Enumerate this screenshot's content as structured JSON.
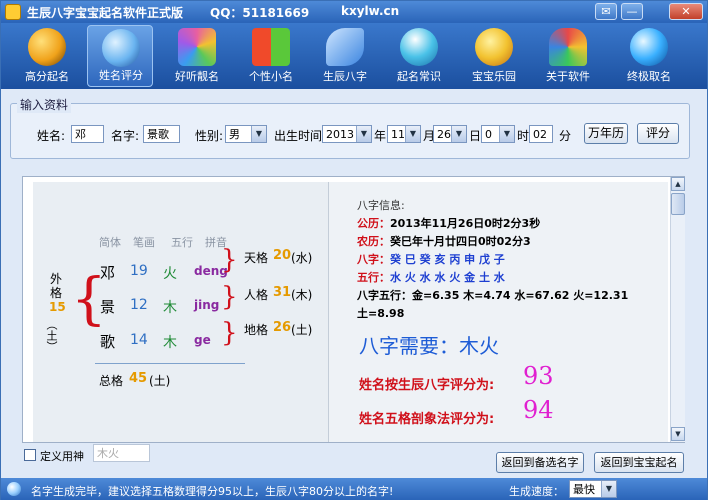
{
  "window": {
    "title": "生辰八字宝宝起名软件正式版",
    "qq": "QQ：51181669",
    "site": "kxylw.cn",
    "controls": [
      "✉",
      "—",
      "✕"
    ]
  },
  "toolbar": {
    "items": [
      {
        "label": "高分起名",
        "icon": "yin-yang-icon",
        "color": "#f0a21a"
      },
      {
        "label": "姓名评分",
        "icon": "globe-icon",
        "color": "#6ab4f0"
      },
      {
        "label": "好听靓名",
        "icon": "cubes-icon",
        "color": "#e85fa0"
      },
      {
        "label": "个性小名",
        "icon": "windows-icon",
        "color": "#f0c21a"
      },
      {
        "label": "生辰八字",
        "icon": "leaves-icon",
        "color": "#5aa0f0"
      },
      {
        "label": "起名常识",
        "icon": "person-icon",
        "color": "#4ac2e8"
      },
      {
        "label": "宝宝乐园",
        "icon": "duck-icon",
        "color": "#f2c230"
      },
      {
        "label": "关于软件",
        "icon": "butterfly-icon",
        "color": "#e84848"
      },
      {
        "label": "终极取名",
        "icon": "ie-globe-icon",
        "color": "#3ab0ff"
      }
    ]
  },
  "input_group": {
    "title": "输入资料",
    "surname_label": "姓名:",
    "surname_value": "邓",
    "name_label": "名字:",
    "name_value": "景歌",
    "gender_label": "性别:",
    "gender_value": "男",
    "birth_label": "出生时间",
    "year_value": "2013",
    "year_unit": "年",
    "month_value": "11",
    "month_unit": "月",
    "day_value": "26",
    "day_unit": "日",
    "hour_value": "0",
    "hour_unit": "时",
    "minute_value": "02",
    "minute_unit": "分",
    "calendar_button": "万年历",
    "score_button": "评分"
  },
  "wuge": {
    "headers": [
      "简体",
      "笔画",
      "五行",
      "拼音"
    ],
    "chars": [
      {
        "char": "邓",
        "strokes": "19",
        "element": "火",
        "pinyin": "deng"
      },
      {
        "char": "景",
        "strokes": "12",
        "element": "木",
        "pinyin": "jing"
      },
      {
        "char": "歌",
        "strokes": "14",
        "element": "木",
        "pinyin": "ge"
      }
    ],
    "outer_label_1": "外",
    "outer_label_2": "格",
    "outer_value": "15",
    "outer_element": "（土）",
    "tian_label": "天格",
    "tian_value": "20",
    "tian_element": "(水)",
    "ren_label": "人格",
    "ren_value": "31",
    "ren_element": "(木)",
    "di_label": "地格",
    "di_value": "26",
    "di_element": "(土)",
    "total_label": "总格",
    "total_value": "45",
    "total_element": "(土)"
  },
  "bazi": {
    "heading": "八字信息:",
    "solar_label": "公历：",
    "solar_value": "2013年11月26日0时2分3秒",
    "lunar_label": "农历：",
    "lunar_value": "癸巳年十月廿四日0时02分3",
    "bazi_label": "八字：",
    "bazi_value": "癸 巳 癸 亥 丙 申 戊 子",
    "wuxing_label": "五行：",
    "wuxing_value": "水 火 水 水 火 金 土 水",
    "bazi_wuxing_line1": "八字五行：金=6.35 木=4.74 水=67.62 火=12.31",
    "bazi_wuxing_line2": "土=8.98",
    "need_text": "八字需要：木火",
    "score1_label": "姓名按生辰八字评分为:",
    "score1_value": "93",
    "score2_label": "姓名五格剖象法评分为:",
    "score2_value": "94"
  },
  "bottom": {
    "custom_god_label": "定义用神",
    "custom_god_value": "木火",
    "back_to_list_button": "返回到备选名字",
    "back_to_baby_button": "返回到宝宝起名"
  },
  "statusbar": {
    "message": "名字生成完毕，建议选择五格数理得分95以上，生辰八字80分以上的名字!",
    "speed_label": "生成速度：",
    "speed_value": "最快"
  }
}
